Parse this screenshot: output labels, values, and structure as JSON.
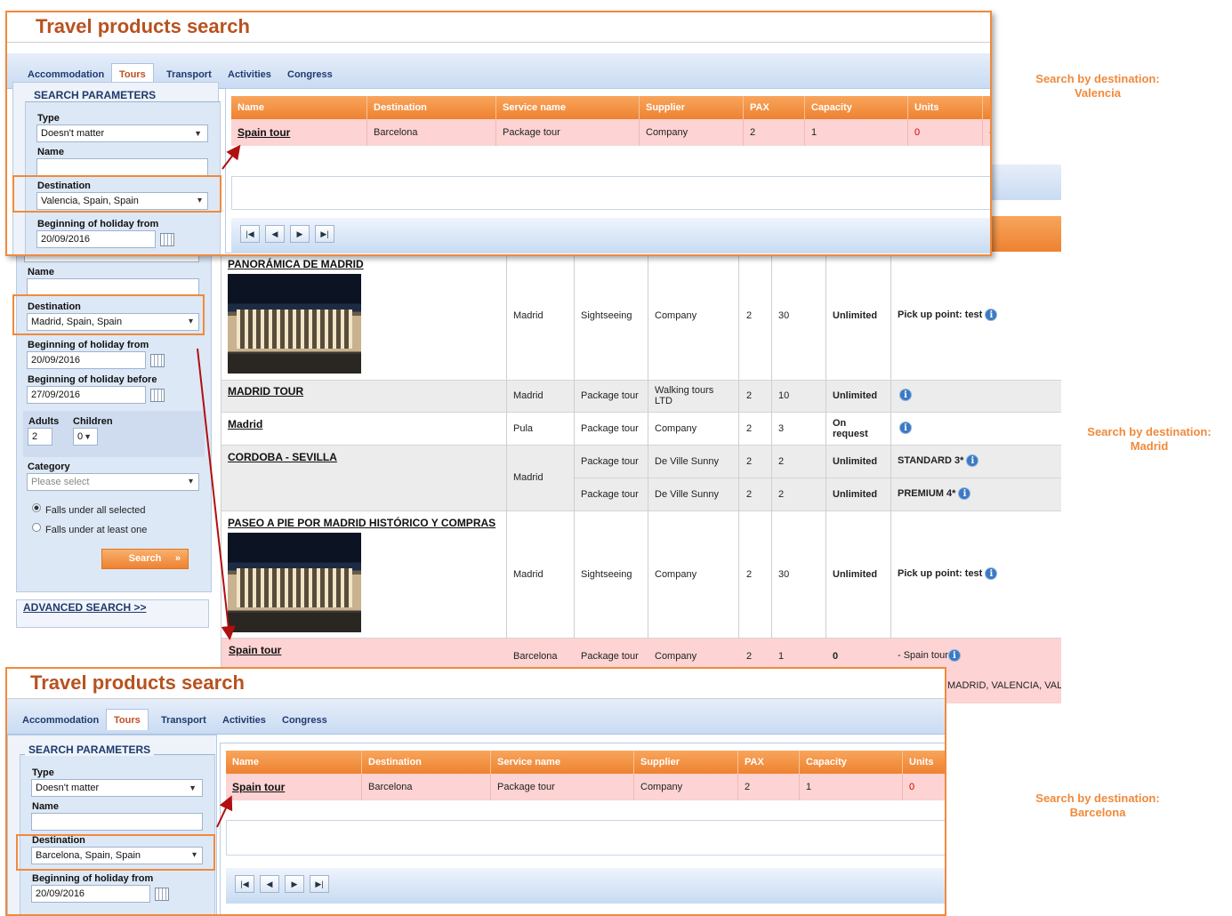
{
  "title": "Travel products search",
  "tabs": [
    "Accommodation",
    "Tours",
    "Transport",
    "Activities",
    "Congress"
  ],
  "active_tab": "Tours",
  "search_panel_title": "SEARCH PARAMETERS",
  "labels": {
    "type": "Type",
    "name": "Name",
    "destination": "Destination",
    "beginning_from": "Beginning of holiday from",
    "beginning_before": "Beginning of holiday before",
    "adults": "Adults",
    "children": "Children",
    "category": "Category"
  },
  "type_value": "Doesn't matter",
  "date_from": "20/09/2016",
  "date_before": "27/09/2016",
  "adults_value": "2",
  "children_value": "0",
  "category_placeholder": "Please select",
  "radio_all": "Falls under all selected",
  "radio_one": "Falls under at least one",
  "search_button": "Search",
  "advanced_search": "ADVANCED SEARCH >>",
  "columns": [
    "Name",
    "Destination",
    "Service name",
    "Supplier",
    "PAX",
    "Capacity",
    "Units"
  ],
  "top_panel": {
    "destination": "Valencia, Spain, Spain",
    "row": {
      "name": "Spain tour",
      "destination": "Barcelona",
      "service": "Package tour",
      "supplier": "Company",
      "pax": "2",
      "capacity": "1",
      "units": "0",
      "extra": "-"
    }
  },
  "bottom_panel": {
    "destination": "Barcelona, Spain, Spain",
    "row": {
      "name": "Spain tour",
      "destination": "Barcelona",
      "service": "Package tour",
      "supplier": "Company",
      "pax": "2",
      "capacity": "1",
      "units": "0"
    }
  },
  "madrid_panel": {
    "destination": "Madrid, Spain, Spain",
    "type_partial": "Doesn't matter",
    "rows": [
      {
        "name": "PANORÁMICA DE MADRID",
        "destination": "Madrid",
        "service": "Sightseeing",
        "supplier": "Company",
        "pax": "2",
        "capacity": "30",
        "units": "Unlimited",
        "info": "Pick up point: test"
      },
      {
        "name": "MADRID TOUR",
        "destination": "Madrid",
        "service": "Package tour",
        "supplier": "Walking tours LTD",
        "pax": "2",
        "capacity": "10",
        "units": "Unlimited",
        "info": ""
      },
      {
        "name": "Madrid",
        "destination": "Pula",
        "service": "Package tour",
        "supplier": "Company",
        "pax": "2",
        "capacity": "3",
        "units": "On request",
        "info": ""
      },
      {
        "name": "CORDOBA - SEVILLA",
        "destination": "Madrid",
        "service": "Package tour",
        "supplier": "De Ville Sunny",
        "pax": "2",
        "capacity": "2",
        "units": "Unlimited",
        "info": "STANDARD 3*",
        "service2": "Package tour",
        "supplier2": "De Ville Sunny",
        "pax2": "2",
        "capacity2": "2",
        "units2": "Unlimited",
        "info2": "PREMIUM 4*"
      },
      {
        "name": "PASEO A PIE POR MADRID HISTÓRICO Y COMPRAS",
        "destination": "Madrid",
        "service": "Sightseeing",
        "supplier": "Company",
        "pax": "2",
        "capacity": "30",
        "units": "Unlimited",
        "info": "Pick up point: test"
      },
      {
        "name": "Spain tour",
        "destination": "Barcelona",
        "service": "Package tour",
        "supplier": "Company",
        "pax": "2",
        "capacity": "1",
        "units": "0",
        "info": "- Spain tour",
        "info_extra": "MADRID, VALENCIA, VALE"
      }
    ]
  },
  "notes": {
    "valencia": [
      "Search by destination:",
      "Valencia"
    ],
    "madrid": [
      "Search by destination:",
      "Madrid"
    ],
    "barcelona": [
      "Search by destination:",
      "Barcelona"
    ]
  },
  "colors": {
    "accent": "#f08a3c",
    "header": "#ee8231",
    "highlight": "#fdd3d3",
    "tabbar": "#c9dbf3",
    "arrow": "#b01010"
  }
}
